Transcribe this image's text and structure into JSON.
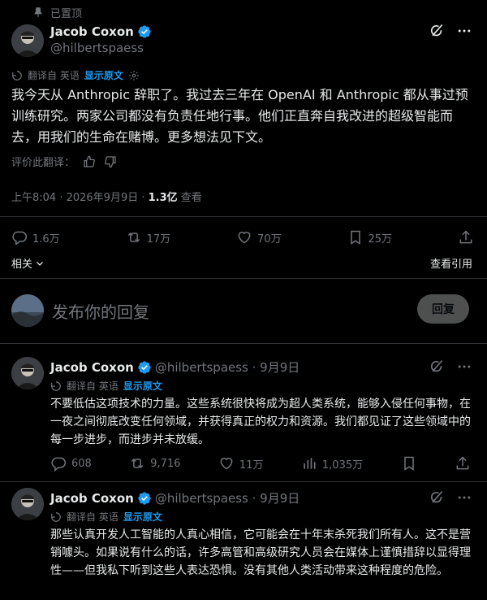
{
  "pinned_label": "已置顶",
  "main_tweet": {
    "display_name": "Jacob Coxon",
    "handle": "@hilbertspaess",
    "translated_from": "翻译自 英语",
    "show_original": "显示原文",
    "text": "我今天从 Anthropic 辞职了。我过去三年在 OpenAI 和 Anthropic 都从事过预训练研究。两家公司都没有负责任地行事。他们正直奔自我改进的超级智能而去，用我们的生命在赌博。更多想法见下文。",
    "rate_translation": "评价此翻译：",
    "time": "上午8:04 · 2026年9月9日 · ",
    "views": "1.3亿",
    "views_label": " 查看",
    "replies": "1.6万",
    "reposts": "17万",
    "likes": "70万",
    "bookmarks": "25万",
    "related": "相关",
    "view_quotes": "查看引用"
  },
  "reply_box": {
    "placeholder": "发布你的回复",
    "button": "回复"
  },
  "replies": [
    {
      "display_name": "Jacob Coxon",
      "handle_date": "@hilbertspaess · 9月9日",
      "translated_from": "翻译自 英语",
      "show_original": "显示原文",
      "text": "不要低估这项技术的力量。这些系统很快将成为超人类系统，能够入侵任何事物，在一夜之间彻底改变任何领域，并获得真正的权力和资源。我们都见证了这些领域中的每一步进步，而进步并未放缓。",
      "replies": "608",
      "reposts": "9,716",
      "likes": "11万",
      "views": "1,035万"
    },
    {
      "display_name": "Jacob Coxon",
      "handle_date": "@hilbertspaess · 9月9日",
      "translated_from": "翻译自 英语",
      "show_original": "显示原文",
      "text": "那些认真开发人工智能的人真心相信，它可能会在十年末杀死我们所有人。这不是营销噱头。如果说有什么的话，许多高管和高级研究人员会在媒体上谨慎措辞以显得理性——但我私下听到这些人表达恐惧。没有其他人类活动带来这种程度的危险。"
    }
  ],
  "icons": {
    "pin": "pin-icon",
    "verified": "verified-badge-icon",
    "grok": "grok-icon",
    "more": "more-icon",
    "translate": "translate-icon",
    "settings": "gear-icon",
    "thumbs_up": "thumbs-up-icon",
    "thumbs_down": "thumbs-down-icon",
    "reply": "reply-icon",
    "repost": "repost-icon",
    "like": "heart-icon",
    "bookmark": "bookmark-icon",
    "share": "share-icon",
    "views": "views-icon",
    "chevron": "chevron-down-icon"
  },
  "colors": {
    "background": "#000000",
    "text": "#e7e9ea",
    "muted": "#71767b",
    "accent": "#1d9bf0",
    "divider": "#2f3336"
  }
}
